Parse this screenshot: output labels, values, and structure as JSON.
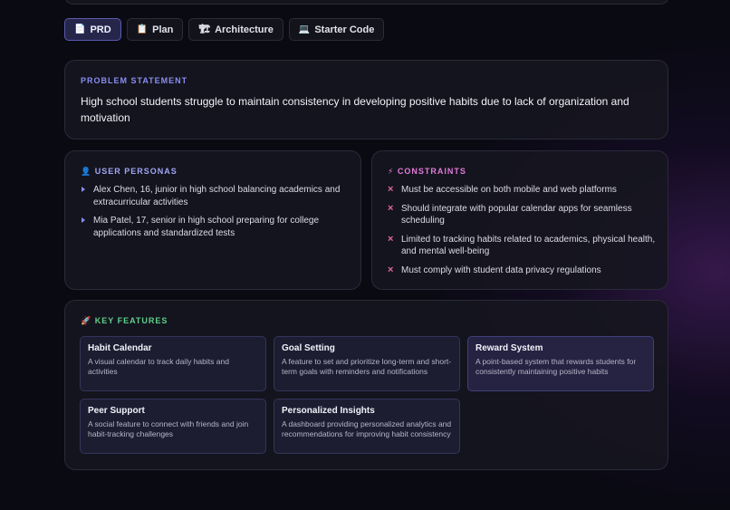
{
  "tabs": [
    {
      "icon": "📄",
      "icon_name": "document-icon",
      "label": "PRD",
      "active": true
    },
    {
      "icon": "📋",
      "icon_name": "clipboard-icon",
      "label": "Plan",
      "active": false
    },
    {
      "icon": "🏗",
      "icon_name": "construction-icon",
      "label": "Architecture",
      "active": false
    },
    {
      "icon": "💻",
      "icon_name": "laptop-icon",
      "label": "Starter Code",
      "active": false
    }
  ],
  "problem": {
    "label": "PROBLEM STATEMENT",
    "text": "High school students struggle to maintain consistency in developing positive habits due to lack of organization and motivation"
  },
  "personas": {
    "icon": "👤",
    "label": "USER PERSONAS",
    "items": [
      "Alex Chen, 16, junior in high school balancing academics and extracurricular activities",
      "Mia Patel, 17, senior in high school preparing for college applications and standardized tests"
    ]
  },
  "constraints": {
    "icon": "⚡",
    "label": "CONSTRAINTS",
    "items": [
      "Must be accessible on both mobile and web platforms",
      "Should integrate with popular calendar apps for seamless scheduling",
      "Limited to tracking habits related to academics, physical health, and mental well-being",
      "Must comply with student data privacy regulations"
    ]
  },
  "features": {
    "icon": "🚀",
    "label": "KEY FEATURES",
    "items": [
      {
        "title": "Habit Calendar",
        "desc": "A visual calendar to track daily habits and activities"
      },
      {
        "title": "Goal Setting",
        "desc": "A feature to set and prioritize long-term and short-term goals with reminders and notifications"
      },
      {
        "title": "Reward System",
        "desc": "A point-based system that rewards students for consistently maintaining positive habits"
      },
      {
        "title": "Peer Support",
        "desc": "A social feature to connect with friends and join habit-tracking challenges"
      },
      {
        "title": "Personalized Insights",
        "desc": "A dashboard providing personalized analytics and recommendations for improving habit consistency"
      }
    ]
  },
  "colors": {
    "accent": "#8a8ef0",
    "constraints_accent": "#e27ad8",
    "features_accent": "#5fcf8a",
    "x_mark": "#e2689a"
  }
}
